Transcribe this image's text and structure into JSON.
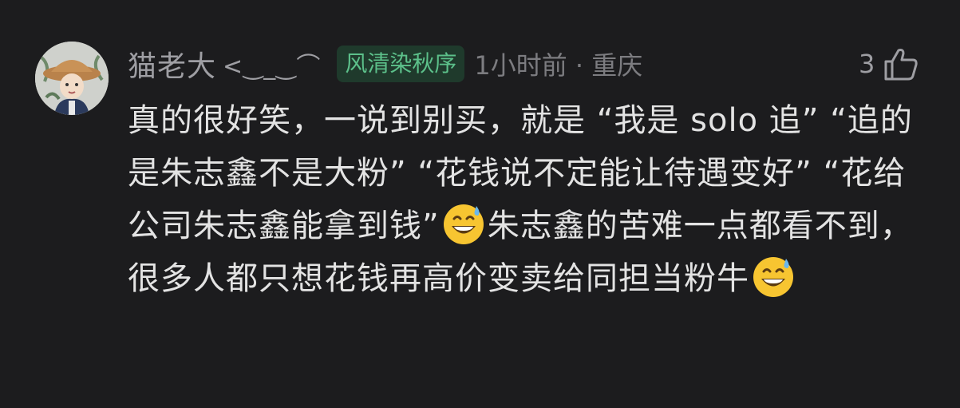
{
  "comment": {
    "username": "猫老大",
    "username_decoration": "<‿_‿⌒",
    "badge": "风清染秋序",
    "meta": "1小时前 · 重庆",
    "like_count": "3",
    "text_segments": [
      "真的很好笑，一说到别买，就是 “我是 solo 追” “追的是朱志鑫不是大粉” “花钱说不定能让待遇变好” “花给公司朱志鑫能拿到钱”",
      "朱志鑫的苦难一点都看不到，很多人都只想花钱再高价变卖给同担当粉牛"
    ],
    "emoji_name": "grinning-face-with-sweat-emoji"
  },
  "colors": {
    "background": "#1c1c1e",
    "username": "#9e9ea3",
    "badge_bg": "#1f3a2c",
    "badge_text": "#5cc08a",
    "meta": "#7c7c80",
    "body_text": "#e3e3e3"
  }
}
